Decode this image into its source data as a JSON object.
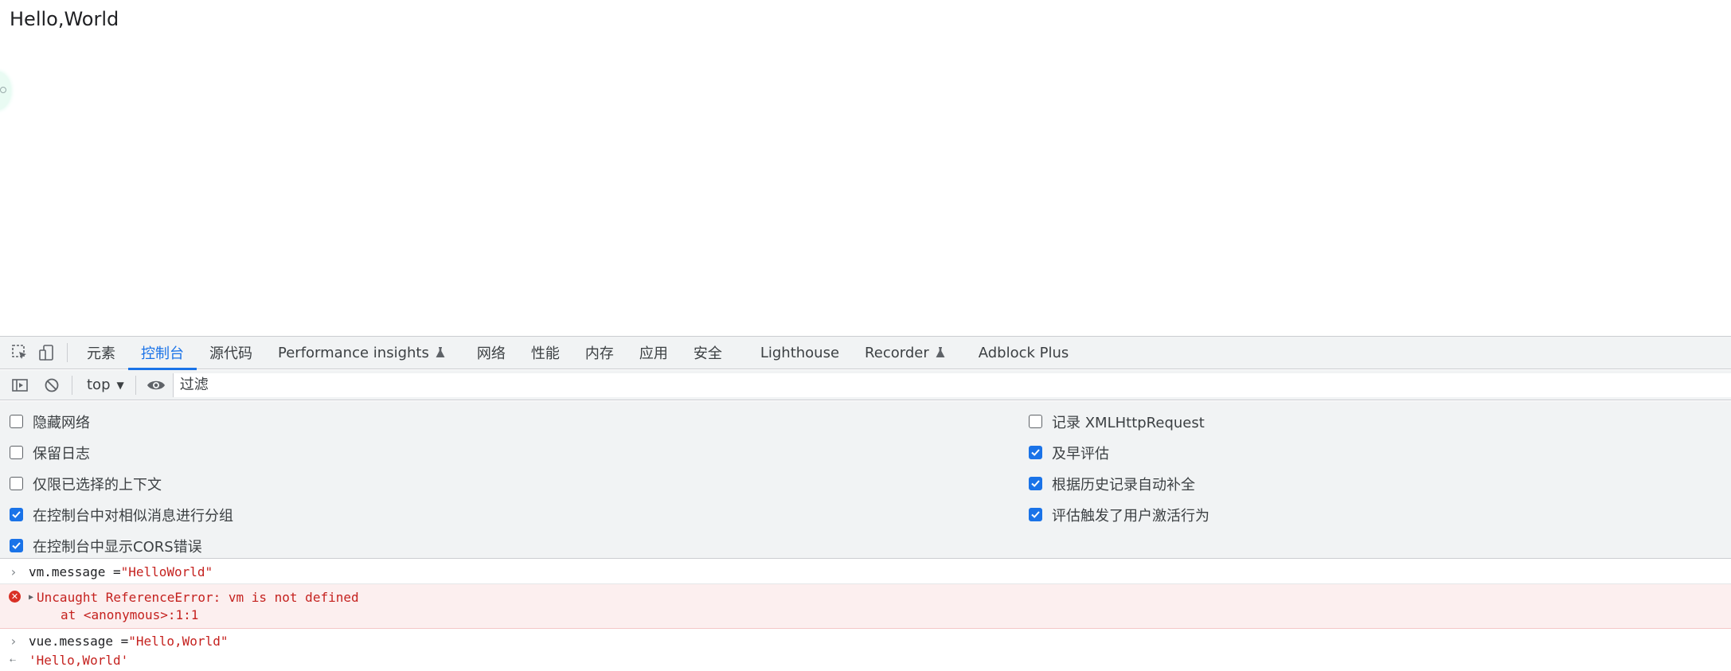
{
  "page": {
    "heading": "Hello,World"
  },
  "devtools": {
    "tabs": [
      {
        "label": "元素"
      },
      {
        "label": "控制台"
      },
      {
        "label": "源代码"
      },
      {
        "label": "Performance insights"
      },
      {
        "label": "网络"
      },
      {
        "label": "性能"
      },
      {
        "label": "内存"
      },
      {
        "label": "应用"
      },
      {
        "label": "安全"
      },
      {
        "label": "Lighthouse"
      },
      {
        "label": "Recorder"
      },
      {
        "label": "Adblock Plus"
      }
    ],
    "active_tab": "控制台",
    "toolbar": {
      "context": "top",
      "filter_placeholder": "过滤"
    },
    "settings": {
      "left": [
        {
          "label": "隐藏网络",
          "checked": false
        },
        {
          "label": "保留日志",
          "checked": false
        },
        {
          "label": "仅限已选择的上下文",
          "checked": false
        },
        {
          "label": "在控制台中对相似消息进行分组",
          "checked": true
        },
        {
          "label": "在控制台中显示CORS错误",
          "checked": true
        }
      ],
      "right": [
        {
          "label": "记录 XMLHttpRequest",
          "checked": false
        },
        {
          "label": "及早评估",
          "checked": true
        },
        {
          "label": "根据历史记录自动补全",
          "checked": true
        },
        {
          "label": "评估触发了用户激活行为",
          "checked": true
        }
      ]
    },
    "console": {
      "line1": {
        "code": "vm.message = ",
        "string": "\"HelloWorld\""
      },
      "error": {
        "message": "Uncaught ReferenceError: vm is not defined",
        "location": "at <anonymous>:1:1"
      },
      "line3": {
        "code": "vue.message = ",
        "string": "\"Hello,World\""
      },
      "result": "'Hello,World'"
    }
  },
  "colors": {
    "accent": "#1a73e8",
    "error": "#c5221f",
    "error_bg": "#fcefef",
    "panel_bg": "#f1f3f4"
  },
  "icons": [
    "inspect-element-icon",
    "device-toolbar-icon",
    "flask-icon",
    "sidebar-toggle-icon",
    "clear-console-icon",
    "dropdown-caret-icon",
    "eye-icon",
    "checkbox-icon",
    "prompt-chevron-icon",
    "error-icon",
    "expand-triangle-icon",
    "result-arrow-icon"
  ]
}
